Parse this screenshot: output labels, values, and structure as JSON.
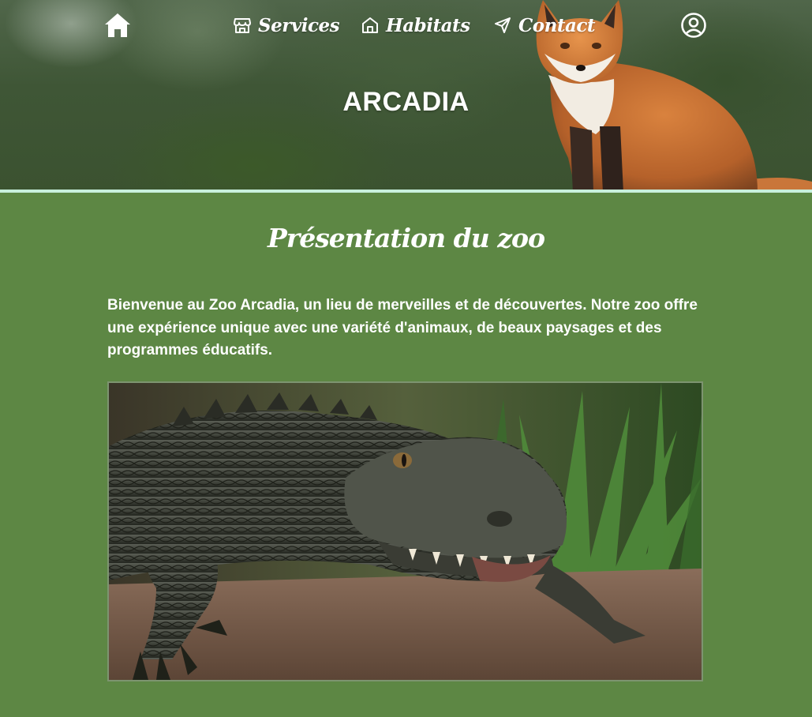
{
  "nav": {
    "home_icon": "home-icon",
    "items": [
      {
        "label": "Services",
        "icon": "store-icon"
      },
      {
        "label": "Habitats",
        "icon": "house-icon"
      },
      {
        "label": "Contact",
        "icon": "send-icon"
      }
    ],
    "account_icon": "user-circle-icon"
  },
  "hero": {
    "title": "ARCADIA",
    "image": "fox-photo"
  },
  "presentation": {
    "heading": "Présentation du zoo",
    "text": "Bienvenue au Zoo Arcadia, un lieu de merveilles et de découvertes. Notre zoo offre une expérience unique avec une variété d'animaux, de beaux paysages et des programmes éducatifs.",
    "image": "crocodile-photo"
  },
  "colors": {
    "page_background": "#5d8744",
    "hero_border": "#c8f0dc",
    "text": "#ffffff"
  }
}
